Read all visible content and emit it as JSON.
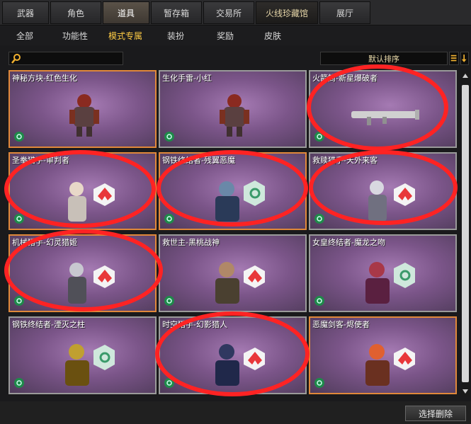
{
  "top_tabs": [
    {
      "label": "武器"
    },
    {
      "label": "角色"
    },
    {
      "label": "道具"
    },
    {
      "label": "暂存箱"
    },
    {
      "label": "交易所"
    },
    {
      "label": "火线珍藏馆"
    },
    {
      "label": "展厅"
    }
  ],
  "sub_tabs": [
    {
      "label": "全部"
    },
    {
      "label": "功能性"
    },
    {
      "label": "模式专属"
    },
    {
      "label": "装扮"
    },
    {
      "label": "奖励"
    },
    {
      "label": "皮肤"
    }
  ],
  "search": {
    "value": "",
    "placeholder": ""
  },
  "sort": {
    "label": "默认排序"
  },
  "items": [
    {
      "name": "神秘方块-红色生化"
    },
    {
      "name": "生化手雷-小红"
    },
    {
      "name": "火箭筒-新星爆破者"
    },
    {
      "name": "圣拳猎手-审判者"
    },
    {
      "name": "钢铁终结者-残翼恶魔"
    },
    {
      "name": "救赎猎手-天外来客"
    },
    {
      "name": "机械猎手-幻灵猎姬"
    },
    {
      "name": "救世主-黑桃战神"
    },
    {
      "name": "女皇终结者-魔龙之吻"
    },
    {
      "name": "钢铁终结者-湮灭之柱"
    },
    {
      "name": "时空猎手-幻影猎人"
    },
    {
      "name": "恶魔剑客-烬使者"
    }
  ],
  "colors": {
    "annotation": "#ff2323",
    "active_subtab": "#ffcc44",
    "card_bg": "#7b5589"
  },
  "footer": {
    "select_delete_label": "选择删除"
  }
}
